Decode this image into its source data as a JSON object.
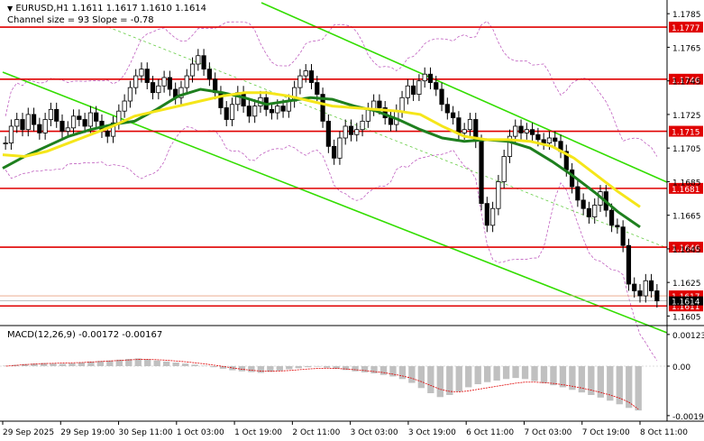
{
  "header": {
    "symbol_line": "EURUSD,H1  1.1611 1.1617 1.1610 1.1614",
    "channel_line": "Channel size = 93 Slope = -0.78",
    "macd_label": "MACD(12,26,9) -0.00172 -0.00167"
  },
  "colors": {
    "background": "#ffffff",
    "bull_candle": "#000000",
    "bear_candle": "#000000",
    "level_line": "#e00000",
    "level_label_bg": "#e00000",
    "level_label_text": "#ffffff",
    "channel_line": "#33dd00",
    "channel_mid": "#66cc44",
    "ma_fast": "#1e7f1e",
    "ma_slow": "#f5e61a",
    "bollinger": "#c060c0",
    "macd_hist": "#c0c0c0",
    "macd_signal": "#e00000"
  },
  "chart_data": {
    "type": "line",
    "title": "EURUSD,H1",
    "price_axis": {
      "ticks": [
        "1.1785",
        "1.1765",
        "1.1745",
        "1.1725",
        "1.1705",
        "1.1685",
        "1.1665",
        "1.1645",
        "1.1625",
        "1.1605"
      ],
      "range": [
        1.1602,
        1.1791
      ]
    },
    "time_axis": {
      "labels": [
        "29 Sep 2025",
        "29 Sep 19:00",
        "30 Sep 11:00",
        "1 Oct 03:00",
        "1 Oct 19:00",
        "2 Oct 11:00",
        "3 Oct 03:00",
        "3 Oct 19:00",
        "6 Oct 11:00",
        "7 Oct 03:00",
        "7 Oct 19:00",
        "8 Oct 11:00"
      ]
    },
    "levels": [
      {
        "value": 1.1777,
        "label": "1.1777"
      },
      {
        "value": 1.1746,
        "label": "1.1746"
      },
      {
        "value": 1.1715,
        "label": "1.1715"
      },
      {
        "value": 1.1681,
        "label": "1.1681"
      },
      {
        "value": 1.1646,
        "label": "1.1646"
      },
      {
        "value": 1.1611,
        "label": "1.1611"
      }
    ],
    "current_price": {
      "value": 1.1614,
      "label": "1.1614"
    },
    "extra_price_tag": {
      "value": 1.1617,
      "label": "1.1617"
    },
    "close_series": [
      1.1708,
      1.1718,
      1.1722,
      1.1716,
      1.1725,
      1.1719,
      1.1714,
      1.1722,
      1.1728,
      1.1721,
      1.1715,
      1.1717,
      1.1724,
      1.1722,
      1.1718,
      1.1726,
      1.1721,
      1.1715,
      1.1712,
      1.172,
      1.1727,
      1.1733,
      1.1741,
      1.1748,
      1.1752,
      1.1744,
      1.1738,
      1.1742,
      1.1747,
      1.174,
      1.1735,
      1.1741,
      1.1748,
      1.1755,
      1.176,
      1.1752,
      1.1746,
      1.1738,
      1.1729,
      1.1722,
      1.1731,
      1.1738,
      1.173,
      1.1724,
      1.173,
      1.1735,
      1.1728,
      1.1726,
      1.173,
      1.1727,
      1.1733,
      1.1741,
      1.1748,
      1.1751,
      1.1744,
      1.1737,
      1.1721,
      1.1706,
      1.1699,
      1.1711,
      1.1718,
      1.1713,
      1.1716,
      1.1721,
      1.1728,
      1.1733,
      1.1729,
      1.1723,
      1.1719,
      1.1727,
      1.1735,
      1.1742,
      1.1737,
      1.1745,
      1.1749,
      1.1744,
      1.174,
      1.1731,
      1.1726,
      1.1723,
      1.1714,
      1.1716,
      1.1722,
      1.1709,
      1.1672,
      1.1659,
      1.1669,
      1.1685,
      1.17,
      1.1712,
      1.1718,
      1.1714,
      1.1716,
      1.1713,
      1.171,
      1.1708,
      1.1711,
      1.1709,
      1.1703,
      1.1692,
      1.1682,
      1.1674,
      1.1669,
      1.1664,
      1.1671,
      1.1679,
      1.1668,
      1.1659,
      1.1658,
      1.1647,
      1.1624,
      1.162,
      1.1617,
      1.1626,
      1.162,
      1.1614
    ],
    "series": [
      {
        "values": [
          1.1693,
          1.17,
          1.1706,
          1.1712,
          1.1716,
          1.1719,
          1.1721,
          1.1728,
          1.1736,
          1.174,
          1.1738,
          1.1735,
          1.1731,
          1.1733,
          1.1735,
          1.1734,
          1.173,
          1.1727,
          1.1722,
          1.1716,
          1.1711,
          1.1709,
          1.171,
          1.1709,
          1.1705,
          1.1697,
          1.1688,
          1.1678,
          1.1667,
          1.1658
        ]
      },
      {
        "values": [
          1.1701,
          1.17,
          1.1703,
          1.1708,
          1.1713,
          1.1718,
          1.1724,
          1.1727,
          1.173,
          1.1733,
          1.1736,
          1.1738,
          1.1738,
          1.1736,
          1.1733,
          1.173,
          1.1729,
          1.1728,
          1.1727,
          1.1725,
          1.1718,
          1.1712,
          1.171,
          1.171,
          1.1709,
          1.1706,
          1.1699,
          1.1689,
          1.1679,
          1.167
        ]
      }
    ],
    "macd": {
      "ticks": [
        "0.00123",
        "0.00",
        "-0.00192"
      ],
      "range": [
        -0.0021,
        0.0014
      ],
      "histogram": [
        2e-05,
        5e-05,
        8e-05,
        0.0001,
        0.00012,
        0.0001,
        9e-05,
        0.00011,
        0.00014,
        0.00018,
        0.0002,
        0.00022,
        0.00025,
        0.00028,
        0.0003,
        0.00027,
        0.00022,
        0.00018,
        0.00014,
        0.0001,
        6e-05,
        2e-05,
        -4e-05,
        -0.0001,
        -0.00016,
        -0.0002,
        -0.00023,
        -0.00026,
        -0.00022,
        -0.00018,
        -0.00012,
        -8e-05,
        -4e-05,
        -2e-05,
        -6e-05,
        -0.0001,
        -0.00015,
        -0.0002,
        -0.00024,
        -0.00028,
        -0.00034,
        -0.0004,
        -0.0005,
        -0.00065,
        -0.00085,
        -0.00105,
        -0.0012,
        -0.00112,
        -0.00098,
        -0.00082,
        -0.0007,
        -0.00062,
        -0.00056,
        -0.0005,
        -0.00046,
        -0.0005,
        -0.00058,
        -0.00066,
        -0.00074,
        -0.00082,
        -0.00092,
        -0.00102,
        -0.00112,
        -0.00122,
        -0.00134,
        -0.00148,
        -0.00162,
        -0.00172
      ],
      "signal": [
        0.0,
        3e-05,
        6e-05,
        8e-05,
        0.0001,
        0.00011,
        0.00012,
        0.00013,
        0.00014,
        0.00016,
        0.00018,
        0.0002,
        0.00022,
        0.00024,
        0.00026,
        0.00026,
        0.00025,
        0.00023,
        0.0002,
        0.00017,
        0.00013,
        9e-05,
        4e-05,
        -1e-05,
        -7e-05,
        -0.00012,
        -0.00016,
        -0.00019,
        -0.0002,
        -0.00019,
        -0.00017,
        -0.00014,
        -0.00011,
        -9e-05,
        -8e-05,
        -9e-05,
        -0.00011,
        -0.00014,
        -0.00017,
        -0.00021,
        -0.00025,
        -0.00031,
        -0.00038,
        -0.00047,
        -0.0006,
        -0.00075,
        -0.0009,
        -0.00098,
        -0.001,
        -0.00096,
        -0.0009,
        -0.00084,
        -0.00078,
        -0.00072,
        -0.00066,
        -0.00062,
        -0.00062,
        -0.00064,
        -0.00067,
        -0.00072,
        -0.00078,
        -0.00085,
        -0.00093,
        -0.00102,
        -0.00112,
        -0.00124,
        -0.0014,
        -0.00167
      ]
    },
    "grid": false
  }
}
